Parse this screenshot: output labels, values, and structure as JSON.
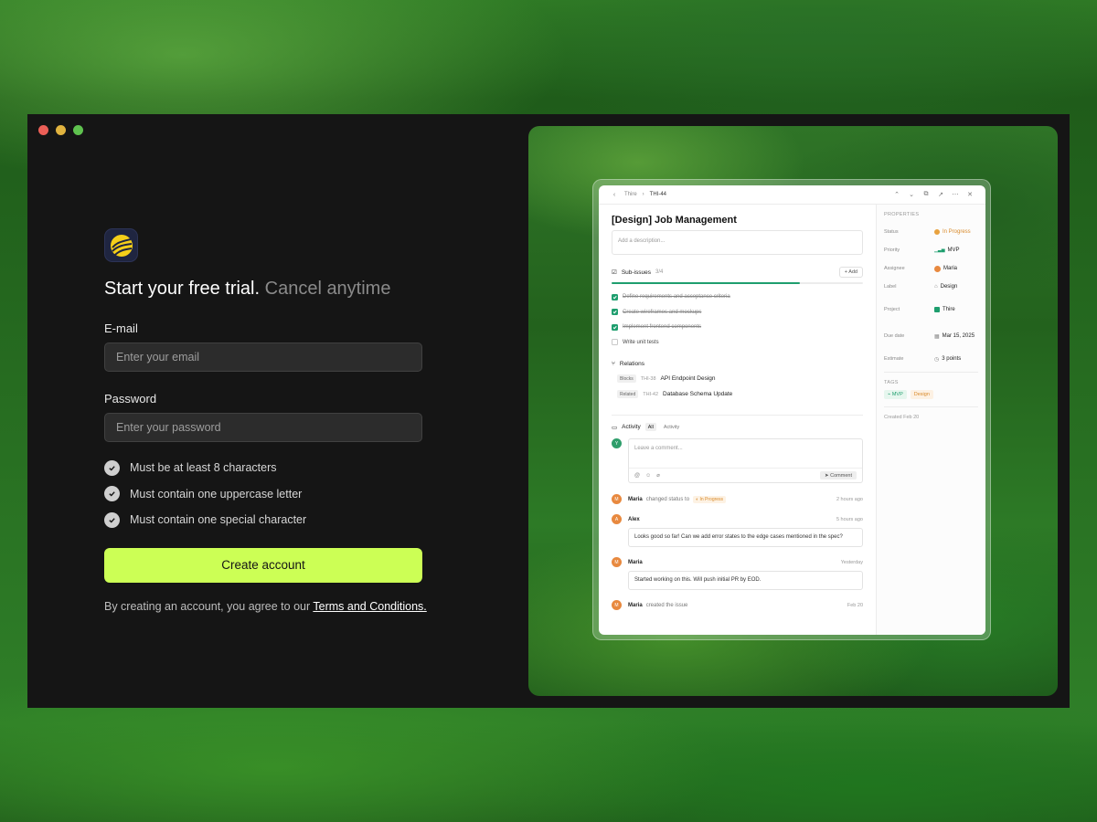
{
  "form": {
    "headline_main": "Start your free trial.",
    "headline_muted": "Cancel anytime",
    "email_label": "E-mail",
    "email_placeholder": "Enter your email",
    "password_label": "Password",
    "password_placeholder": "Enter your password",
    "rules": [
      "Must be at least 8 characters",
      "Must contain one uppercase letter",
      "Must contain one special character"
    ],
    "create_label": "Create account",
    "terms_prefix": "By creating an account, you agree to our",
    "terms_link": "Terms and Conditions."
  },
  "colors": {
    "accent": "#ccff55",
    "window_bg": "#151515",
    "success": "#1e9e6e",
    "in_progress": "#d98a2a"
  },
  "preview": {
    "breadcrumb": {
      "workspace": "Thire",
      "issue": "THI-44"
    },
    "title": "[Design] Job Management",
    "description_placeholder": "Add a description...",
    "subissues": {
      "label": "Sub-issues",
      "count": "3/4",
      "progress": 0.75,
      "add_label": "+ Add",
      "items": [
        {
          "text": "Define requirements and acceptance criteria",
          "done": true
        },
        {
          "text": "Create wireframes and mockups",
          "done": true
        },
        {
          "text": "Implement frontend components",
          "done": true
        },
        {
          "text": "Write unit tests",
          "done": false
        }
      ]
    },
    "relations": {
      "label": "Relations",
      "items": [
        {
          "type": "Blocks",
          "id": "THI-38",
          "title": "API Endpoint Design"
        },
        {
          "type": "Related",
          "id": "THI-42",
          "title": "Database Schema Update"
        }
      ]
    },
    "activity": {
      "label": "Activity",
      "tabs": [
        "All",
        "Activity"
      ],
      "comment_placeholder": "Leave a comment...",
      "comment_button": "Comment",
      "current_user_initial": "Y",
      "events": [
        {
          "initial": "M",
          "user": "Maria",
          "action": "changed status to",
          "status": "In Progress",
          "time": "2 hours ago"
        },
        {
          "initial": "A",
          "user": "Alex",
          "time": "5 hours ago",
          "comment": "Looks good so far! Can we add error states to the edge cases mentioned in the spec?"
        },
        {
          "initial": "M",
          "user": "Maria",
          "time": "Yesterday",
          "comment": "Started working on this. Will push initial PR by EOD."
        },
        {
          "initial": "M",
          "user": "Maria",
          "action": "created the issue",
          "time": "Feb 20"
        }
      ]
    },
    "properties": {
      "label": "PROPERTIES",
      "status": {
        "key": "Status",
        "value": "In Progress"
      },
      "priority": {
        "key": "Priority",
        "value": "MVP"
      },
      "assignee": {
        "key": "Assignee",
        "value": "Maria"
      },
      "label_prop": {
        "key": "Label",
        "value": "Design"
      },
      "project": {
        "key": "Project",
        "value": "Thire"
      },
      "due": {
        "key": "Due date",
        "value": "Mar 15, 2025"
      },
      "estimate": {
        "key": "Estimate",
        "value": "3 points"
      },
      "tags_label": "TAGS",
      "tags": [
        "MVP",
        "Design"
      ],
      "created": "Created Feb 20"
    }
  }
}
